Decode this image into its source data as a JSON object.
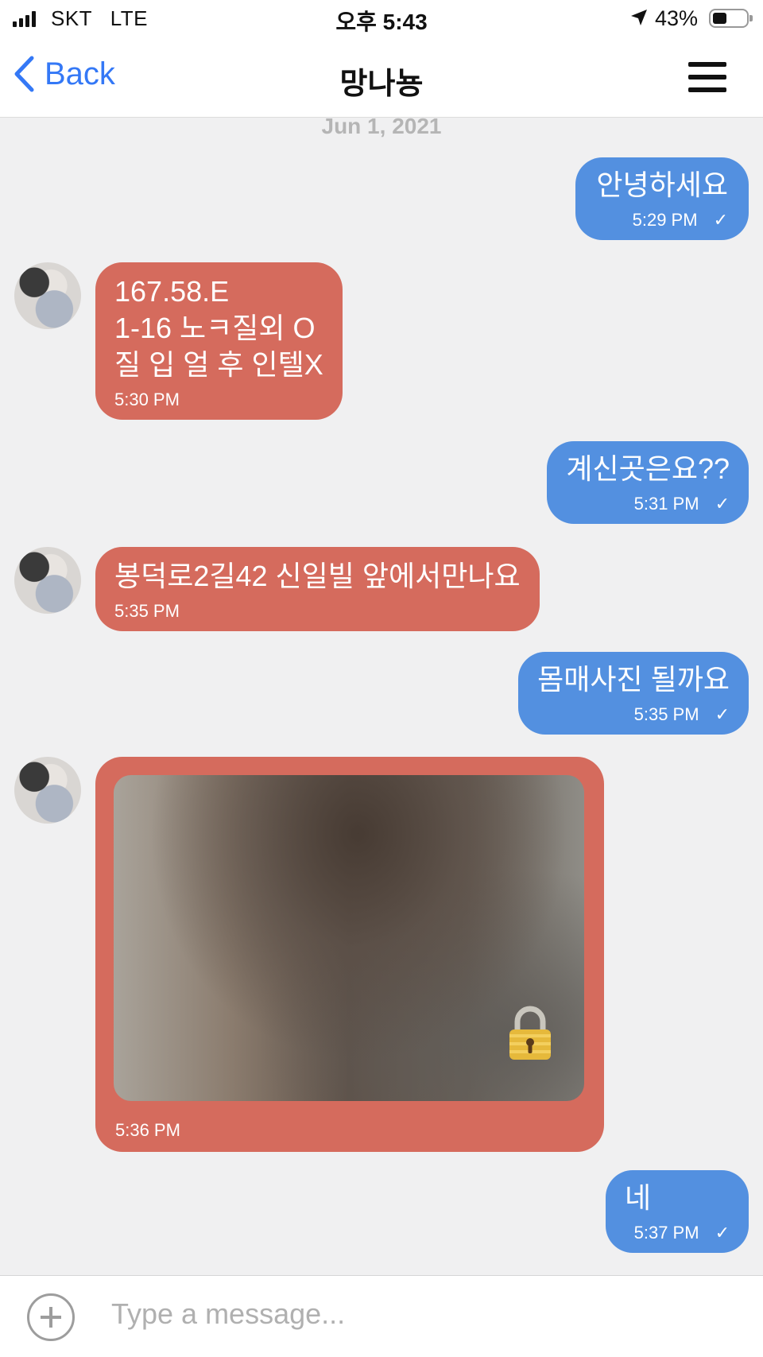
{
  "status_bar": {
    "carrier": "SKT   LTE",
    "time": "오후 5:43",
    "battery": "43%",
    "location_icon": "location-arrow-icon",
    "battery_icon": "battery-icon"
  },
  "header": {
    "back_label": "Back",
    "title": "망나뇽",
    "menu_icon": "hamburger-menu-icon"
  },
  "date_divider": "Jun 1, 2021",
  "messages": [
    {
      "dir": "out",
      "text": "안녕하세요",
      "time": "5:29 PM",
      "check": "✓"
    },
    {
      "dir": "in",
      "text": "167.58.E\n1-16 노ㅋ질외 O\n질 입 얼 후 인텔X",
      "time": "5:30 PM"
    },
    {
      "dir": "out",
      "text": "계신곳은요??",
      "time": "5:31 PM",
      "check": "✓"
    },
    {
      "dir": "in",
      "text": "봉덕로2길42 신일빌 앞에서만나요",
      "time": "5:35 PM"
    },
    {
      "dir": "out",
      "text": "몸매사진 될까요",
      "time": "5:35 PM",
      "check": "✓"
    },
    {
      "dir": "in",
      "type": "locked-image",
      "time": "5:36 PM",
      "icon": "padlock-icon"
    },
    {
      "dir": "out",
      "text": "네",
      "time": "5:37 PM",
      "check": "✓"
    }
  ],
  "composer": {
    "placeholder": "Type a message...",
    "add_icon": "plus-circle-icon"
  },
  "colors": {
    "outgoing": "#5390e0",
    "incoming": "#d56b5d",
    "accent": "#3478f6",
    "background": "#f0f0f1"
  }
}
